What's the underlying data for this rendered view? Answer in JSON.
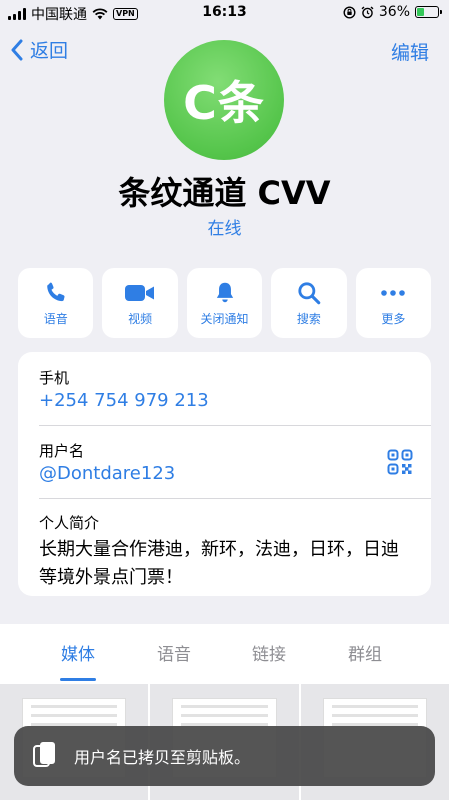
{
  "status": {
    "carrier": "中国联通",
    "vpn": "VPN",
    "time": "16:13",
    "battery": "36%",
    "battery_level": 0.36
  },
  "nav": {
    "back": "返回",
    "edit": "编辑"
  },
  "profile": {
    "avatar_text": "C条",
    "name": "条纹通道 CVV",
    "status": "在线"
  },
  "actions": [
    {
      "label": "语音",
      "icon": "phone-icon"
    },
    {
      "label": "视频",
      "icon": "video-icon"
    },
    {
      "label": "关闭通知",
      "icon": "bell-icon"
    },
    {
      "label": "搜索",
      "icon": "search-icon"
    },
    {
      "label": "更多",
      "icon": "more-icon"
    }
  ],
  "info": {
    "phone_label": "手机",
    "phone": "+254 754 979 213",
    "username_label": "用户名",
    "username": "@Dontdare123",
    "bio_label": "个人简介",
    "bio": "长期大量合作港迪，新环，法迪，日环，日迪等境外景点门票！"
  },
  "tabs": [
    "媒体",
    "语音",
    "链接",
    "群组"
  ],
  "toast": "用户名已拷贝至剪贴板。",
  "colors": {
    "accent": "#2f7ee4",
    "avatar": "#5ac850",
    "background": "#efeff4"
  }
}
